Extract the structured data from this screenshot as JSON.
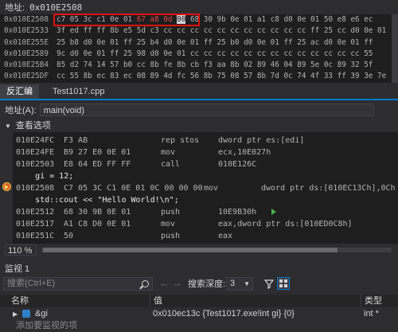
{
  "memory": {
    "address_label": "地址:",
    "address_value": "0x010E2508",
    "rows": [
      {
        "addr": "0x010E2508",
        "pre": "c7 05 3c c1 0e 01 ",
        "changed": "67 a8 0d",
        "cursor": "00",
        "post": " 68 30 9b 0e 01 a1 c8 d0 0e 01 50 e8 e6 ec"
      },
      {
        "addr": "0x010E2533",
        "text": "3f ed ff ff 8b e5 5d c3 cc cc cc cc cc cc cc cc cc cc cc ff 25 cc d0 0e 01"
      },
      {
        "addr": "0x010E255E",
        "text": "25 b8 d0 0e 01 ff 25 b4 d0 0e 01 ff 25 b0 d0 0e 01 ff 25 ac d0 0e 01 ff"
      },
      {
        "addr": "0x010E2589",
        "text": "9c d0 0e 01 ff 25 98 d0 0e 01 cc cc cc cc cc cc cc cc cc cc cc cc cc 55"
      },
      {
        "addr": "0x010E25B4",
        "text": "85 d2 74 14 57 b0 cc 8b fe 8b cb f3 aa 8b 02 89 46 04 89 5e 0c 89 32 5f"
      },
      {
        "addr": "0x010E25DF",
        "text": "cc 55 8b ec 83 ec 08 89 4d fc 56 8b 75 08 57 8b 7d 0c 74 4f 33 ff 39 3e 7e"
      }
    ]
  },
  "tabs": {
    "disasm": "反汇编",
    "file": "Test1017.cpp"
  },
  "disasm": {
    "address_label": "地址(A):",
    "address_value": "main(void)",
    "view_options": "查看选项",
    "lines": [
      {
        "addr": "010E24FC",
        "bytes": "F3 AB",
        "mn": "rep stos",
        "op": "dword ptr es:[edi]"
      },
      {
        "addr": "010E24FE",
        "bytes": "B9 27 E0 0E 01",
        "mn": "mov",
        "op": "ecx,10E027h"
      },
      {
        "addr": "010E2503",
        "bytes": "E8 64 ED FF FF",
        "mn": "call",
        "op": "010E126C"
      },
      {
        "src": "    gi = 12;"
      },
      {
        "addr": "010E2508",
        "bytes": "C7 05 3C C1 0E 01 0C 00 00 00",
        "mn": "mov",
        "op": "dword ptr ds:[010EC13Ch],0Ch"
      },
      {
        "src": "    std::cout << \"Hello World!\\n\";"
      },
      {
        "addr": "010E2512",
        "bytes": "68 30 9B 0E 01",
        "mn": "push",
        "op": "10E9B30h"
      },
      {
        "addr": "010E2517",
        "bytes": "A1 C8 D0 0E 01",
        "mn": "mov",
        "op": "eax,dword ptr ds:[010ED0C8h]"
      },
      {
        "addr": "010E251C",
        "bytes": "50",
        "mn": "push",
        "op": "eax"
      }
    ]
  },
  "zoom": "110 %",
  "watch": {
    "title": "监视 1",
    "search_placeholder": "搜索(Ctrl+E)",
    "depth_label": "搜索深度:",
    "depth_value": "3",
    "columns": {
      "name": "名称",
      "value": "值",
      "type": "类型"
    },
    "rows": [
      {
        "name": "&gi",
        "value": "0x010ec13c {Test1017.exe!int gi} {0}",
        "type": "int *"
      }
    ],
    "add_placeholder": "添加要监视的项"
  }
}
